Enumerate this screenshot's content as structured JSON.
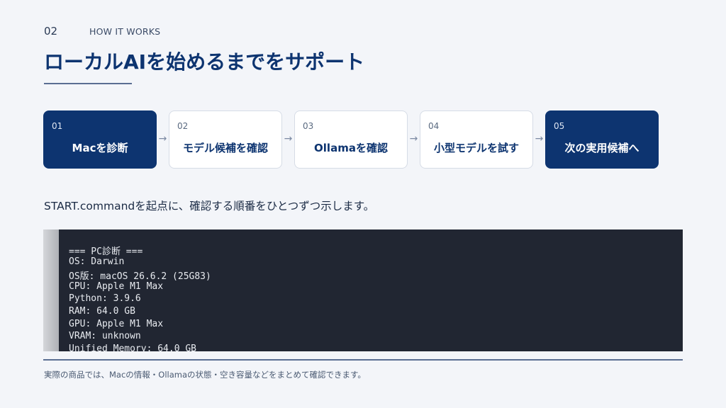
{
  "header": {
    "section_number": "02",
    "section_label": "HOW IT WORKS",
    "title": "ローカルAIを始めるまでをサポート"
  },
  "steps": [
    {
      "number": "01",
      "label": "Macを診断",
      "active": true
    },
    {
      "number": "02",
      "label": "モデル候補を確認",
      "active": false
    },
    {
      "number": "03",
      "label": "Ollamaを確認",
      "active": false
    },
    {
      "number": "04",
      "label": "小型モデルを試す",
      "active": false
    },
    {
      "number": "05",
      "label": "次の実用候補へ",
      "active": true
    }
  ],
  "arrow_glyph": "→",
  "subtitle": "START.commandを起点に、確認する順番をひとつずつ示します。",
  "terminal": {
    "lines": [
      "=== PC診断 ===",
      "OS: Darwin",
      "OS版: macOS 26.6.2 (25G83)",
      "CPU: Apple M1 Max",
      "Python: 3.9.6",
      "RAM: 64.0 GB",
      "GPU: Apple M1 Max",
      "VRAM: unknown",
      "Unified Memory: 64.0 GB"
    ]
  },
  "footer": "実際の商品では、Macの情報・Ollamaの状態・空き容量などをまとめて確認できます。",
  "colors": {
    "accent_navy": "#0d3470",
    "background": "#f3f5f9",
    "terminal_bg": "#212632"
  }
}
